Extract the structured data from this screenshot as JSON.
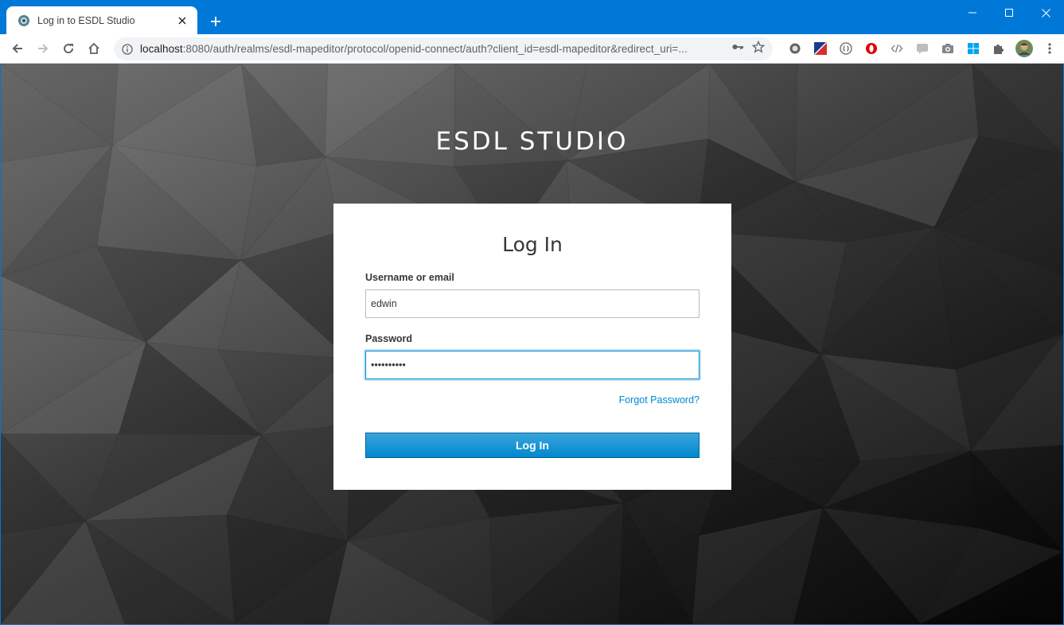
{
  "browser": {
    "tab": {
      "title": "Log in to ESDL Studio"
    },
    "address": {
      "host": "localhost",
      "path": ":8080/auth/realms/esdl-mapeditor/protocol/openid-connect/auth?client_id=esdl-mapeditor&redirect_uri=..."
    }
  },
  "page": {
    "brand": "ESDL STUDIO",
    "card_title": "Log In",
    "username_label": "Username or email",
    "username_value": "edwin",
    "password_label": "Password",
    "password_value": "••••••••••",
    "forgot_link": "Forgot Password?",
    "submit_label": "Log In"
  },
  "colors": {
    "titlebar": "#0078d7",
    "link": "#0088ce",
    "button_top": "#39a5dc",
    "button_bottom": "#0088ce"
  }
}
